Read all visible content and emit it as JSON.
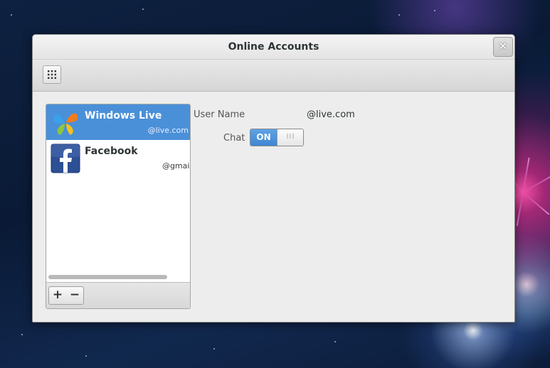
{
  "window": {
    "title": "Online Accounts",
    "close_glyph": "✕"
  },
  "toolbar": {
    "apps_icon": "grid-icon"
  },
  "accounts": [
    {
      "name": "Windows Live",
      "id": "@live.com",
      "icon": "windows-live-icon",
      "selected": true
    },
    {
      "name": "Facebook",
      "id": "@gmail.",
      "icon": "facebook-icon",
      "selected": false
    }
  ],
  "list_footer": {
    "add_label": "+",
    "remove_label": "−"
  },
  "details": {
    "username_label": "User Name",
    "username_value": "@live.com",
    "chat_label": "Chat",
    "chat_state": "ON",
    "chat_knob": "III"
  },
  "colors": {
    "selection": "#4a90d9",
    "switch_on": "#4a90d9"
  }
}
